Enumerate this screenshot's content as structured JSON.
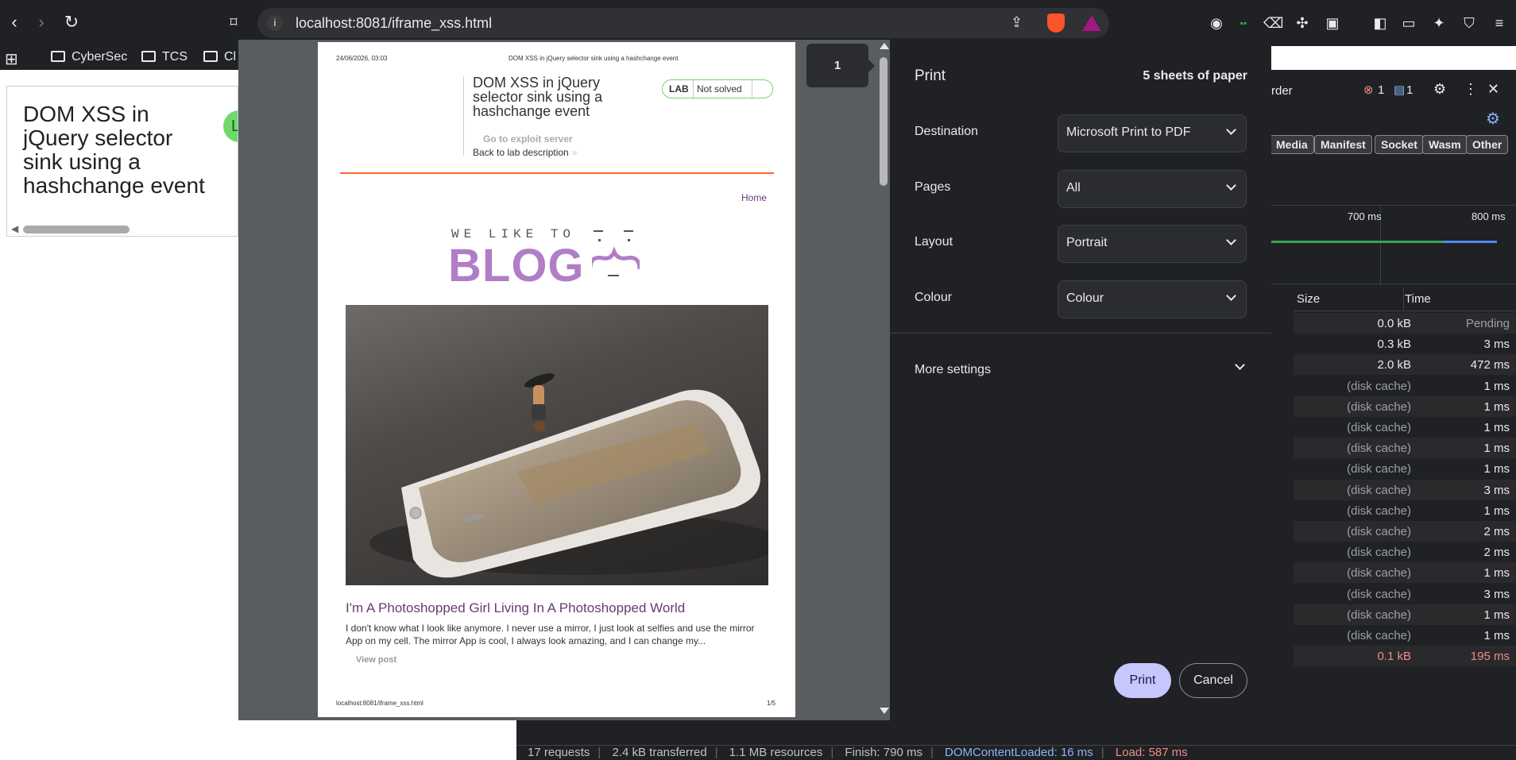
{
  "browser": {
    "url": "localhost:8081/iframe_xss.html",
    "bookmarks": [
      "CyberSec",
      "TCS",
      "Cl"
    ]
  },
  "left_page": {
    "title": "DOM XSS in jQuery selector sink using a hashchange event",
    "badge": "L"
  },
  "devtools": {
    "recorder_label": "rder",
    "errors_count": "1",
    "messages_count": "1",
    "filters": [
      "Media",
      "Manifest",
      "Socket",
      "Wasm",
      "Other"
    ],
    "timeline_labels": [
      "700 ms",
      "800 ms"
    ],
    "columns": {
      "size": "Size",
      "time": "Time"
    },
    "rows": [
      {
        "size": "0.0 kB",
        "time": "Pending"
      },
      {
        "size": "0.3 kB",
        "time": "3 ms"
      },
      {
        "size": "2.0 kB",
        "time": "472 ms"
      },
      {
        "size": "(disk cache)",
        "time": "1 ms"
      },
      {
        "size": "(disk cache)",
        "time": "1 ms"
      },
      {
        "size": "(disk cache)",
        "time": "1 ms"
      },
      {
        "size": "(disk cache)",
        "time": "1 ms"
      },
      {
        "size": "(disk cache)",
        "time": "1 ms"
      },
      {
        "size": "(disk cache)",
        "time": "3 ms"
      },
      {
        "size": "(disk cache)",
        "time": "1 ms"
      },
      {
        "size": "(disk cache)",
        "time": "2 ms"
      },
      {
        "size": "(disk cache)",
        "time": "2 ms"
      },
      {
        "size": "(disk cache)",
        "time": "1 ms"
      },
      {
        "size": "(disk cache)",
        "time": "3 ms"
      },
      {
        "size": "(disk cache)",
        "time": "1 ms"
      },
      {
        "size": "(disk cache)",
        "time": "1 ms"
      },
      {
        "size": "0.1 kB",
        "time": "195 ms"
      }
    ],
    "status": {
      "requests": "17 requests",
      "transferred": "2.4 kB transferred",
      "resources": "1.1 MB resources",
      "finish": "Finish: 790 ms",
      "dcl": "DOMContentLoaded: 16 ms",
      "load": "Load: 587 ms"
    }
  },
  "print_preview": {
    "page_number": "1",
    "header_date": "24/06/2026, 03:03",
    "header_title": "DOM XSS in jQuery selector sink using a hashchange event",
    "lab_title": "DOM XSS in jQuery selector sink using a hashchange event",
    "lab_tag": "LAB",
    "lab_status": "Not solved",
    "exploit_link": "Go to exploit server",
    "back_link": "Back to lab description",
    "back_chevron": "»",
    "home_link": "Home",
    "logo_small": "WE LIKE TO",
    "logo_big": "BLOG",
    "post_title": "I'm A Photoshopped Girl Living In A Photoshopped World",
    "post_body": "I don't know what I look like anymore. I never use a mirror, I just look at selfies and use the mirror App on my cell. The mirror App is cool, I always look amazing, and I can change my...",
    "view_post": "View post",
    "footer_url": "localhost:8081/iframe_xss.html",
    "footer_page": "1/5"
  },
  "print_settings": {
    "title": "Print",
    "sheets": "5 sheets of paper",
    "destination_label": "Destination",
    "destination_value": "Microsoft Print to PDF",
    "pages_label": "Pages",
    "pages_value": "All",
    "layout_label": "Layout",
    "layout_value": "Portrait",
    "colour_label": "Colour",
    "colour_value": "Colour",
    "more_settings": "More settings",
    "print_button": "Print",
    "cancel_button": "Cancel"
  },
  "colors": {
    "print_button": "#c7c6fd",
    "dialog_bg": "#202124",
    "blog_purple": "#b07ec7",
    "lab_green": "#70d96b",
    "accent_orange": "#ff6633"
  }
}
